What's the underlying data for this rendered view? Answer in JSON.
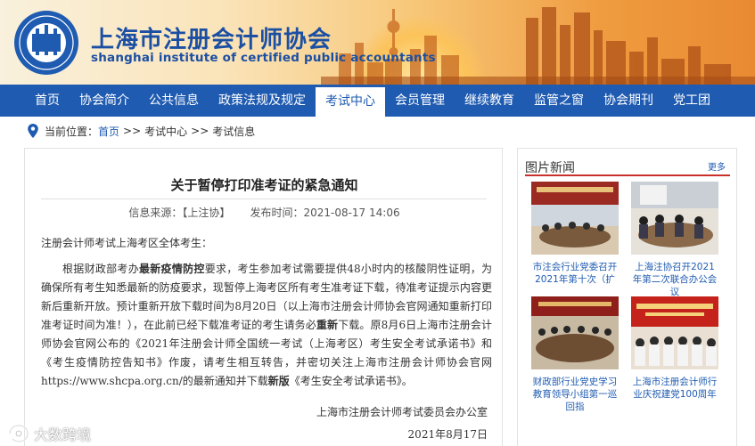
{
  "header": {
    "logo_text": "注册会计师",
    "title_cn": "上海市注册会计师协会",
    "title_en": "shanghai institute of certified public accountants"
  },
  "nav": {
    "items": [
      {
        "label": "首页"
      },
      {
        "label": "协会简介"
      },
      {
        "label": "公共信息"
      },
      {
        "label": "政策法规及规定"
      },
      {
        "label": "考试中心",
        "active": true
      },
      {
        "label": "会员管理"
      },
      {
        "label": "继续教育"
      },
      {
        "label": "监管之窗"
      },
      {
        "label": "协会期刊"
      },
      {
        "label": "党工团"
      }
    ]
  },
  "breadcrumb": {
    "prefix": "当前位置：",
    "home": "首页",
    "sep1": ">>",
    "level1": "考试中心",
    "sep2": ">>",
    "level2": "考试信息"
  },
  "article": {
    "title": "关于暂停打印准考证的紧急通知",
    "source_label": "信息来源：",
    "source_value": "【上注协】",
    "time_label": "发布时间：",
    "time_value": "2021-08-17 14:06",
    "greeting": "注册会计师考试上海考区全体考生：",
    "p1_a": "根据财政部考办",
    "p1_b": "最新疫情防控",
    "p1_c": "要求，考生参加考试需要提供48小时内的核酸阴性证明，为确保所有考生知悉最新的防疫要求，现暂停上海考区所有考生准考证下载，待准考证提示内容更新后重新开放。预计重新开放下载时间为8月20日（以上海市注册会计师协会官网通知重新打印准考证时间为准！），在此前已经下载准考证的考生请务必",
    "p1_d": "重新",
    "p1_e": "下载。原8月6日上海市注册会计师协会官网公布的《2021年注册会计师全国统一考试（上海考区）考生安全考试承诺书》和《考生疫情防控告知书》作废，请考生相互转告，并密切关注上海市注册会计师协会官网https://www.shcpa.org.cn/的最新通知并下载",
    "p1_f": "新版",
    "p1_g": "《考生安全考试承诺书》。",
    "sign_org": "上海市注册会计师考试委员会办公室",
    "sign_date": "2021年8月17日"
  },
  "sidebar": {
    "heading": "图片新闻",
    "more": "更多",
    "photos": [
      {
        "caption": "市注会行业党委召开2021年第十次（扩"
      },
      {
        "caption": "上海注协召开2021年第二次联合办公会议"
      },
      {
        "caption": "财政部行业党史学习教育领导小组第一巡回指"
      },
      {
        "caption": "上海市注册会计师行业庆祝建党100周年"
      }
    ]
  },
  "watermark": {
    "text": "大数跨境"
  },
  "colors": {
    "brand_blue": "#1f5bb1",
    "accent_red": "#c9302c",
    "banner_orange": "#ef9b3f"
  }
}
